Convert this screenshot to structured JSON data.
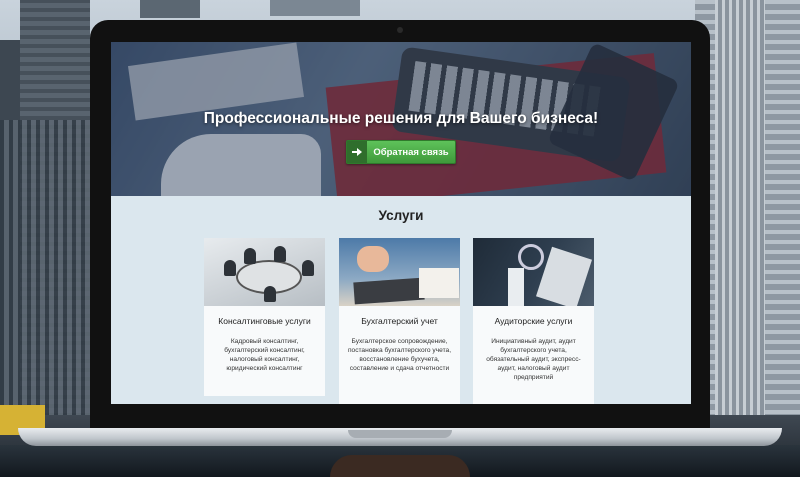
{
  "hero": {
    "title": "Профессиональные решения для Вашего бизнеса!",
    "callback_label": "Обратная связь"
  },
  "services": {
    "title": "Услуги",
    "cards": [
      {
        "title": "Консалтинговые услуги",
        "text": "Кадровый консалтинг, бухгалтерский консалтинг, налоговый консалтинг, юридический консалтинг"
      },
      {
        "title": "Бухгалтерский учет",
        "text": "Бухгалтерское сопровождение, постановка бухгалтерского учета, восстановление бухучета, составление и сдача отчетности"
      },
      {
        "title": "Аудиторские услуги",
        "text": "Инициативный аудит, аудит бухгалтерского учета, обязательный аудит, экспресс-аудит, налоговый аудит предприятий"
      }
    ]
  },
  "colors": {
    "accent_green": "#4cae48",
    "page_bg": "#dbe7ee"
  }
}
